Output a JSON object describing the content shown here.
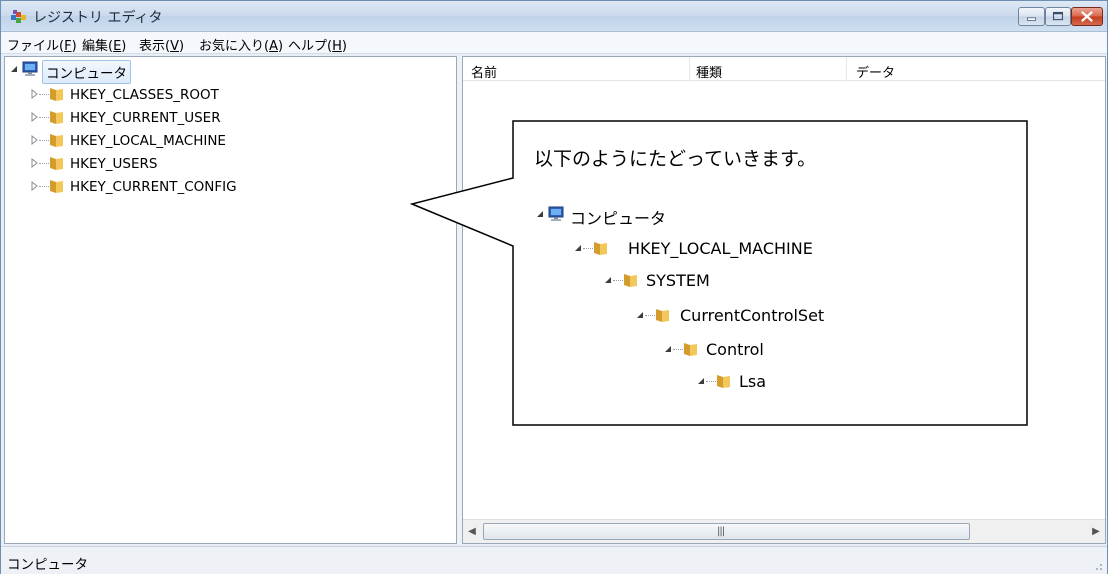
{
  "window": {
    "title": "レジストリ エディタ",
    "icon": "registry-icon"
  },
  "caption_buttons": [
    "minimize-icon",
    "maximize-icon",
    "close-icon"
  ],
  "menu": [
    {
      "label": "ファイル(",
      "key": "F",
      "tail": ")"
    },
    {
      "label": "編集(",
      "key": "E",
      "tail": ")"
    },
    {
      "label": "表示(",
      "key": "V",
      "tail": ")"
    },
    {
      "label": "お気に入り(",
      "key": "A",
      "tail": ")"
    },
    {
      "label": "ヘルプ(",
      "key": "H",
      "tail": ")"
    }
  ],
  "tree": {
    "root": "コンピュータ",
    "items": [
      "HKEY_CLASSES_ROOT",
      "HKEY_CURRENT_USER",
      "HKEY_LOCAL_MACHINE",
      "HKEY_USERS",
      "HKEY_CURRENT_CONFIG"
    ]
  },
  "list": {
    "columns": [
      "名前",
      "種類",
      "データ"
    ]
  },
  "callout": {
    "text": "以下のようにたどっていきます。",
    "path": [
      "コンピュータ",
      "HKEY_LOCAL_MACHINE",
      "SYSTEM",
      "CurrentControlSet",
      "Control",
      "Lsa"
    ]
  },
  "status": {
    "text": "コンピュータ"
  },
  "colors": {
    "titlebar": "#c9d9ec",
    "close_button": "#c53b1e",
    "folder": "#e8b84a"
  }
}
